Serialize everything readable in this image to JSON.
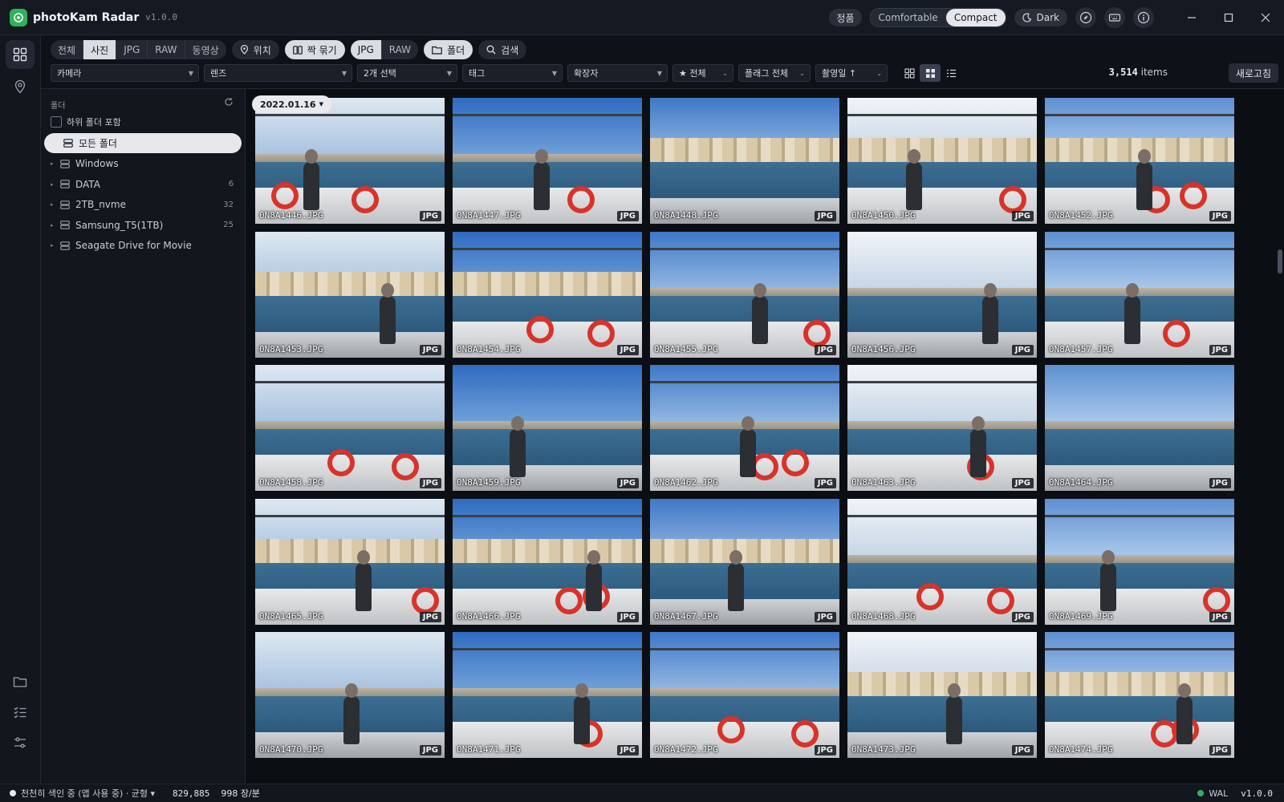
{
  "app": {
    "title": "photoKam Radar",
    "version": "v1.0.0"
  },
  "titlebar": {
    "license": "정품",
    "density": [
      "Comfortable",
      "Compact"
    ],
    "theme": "Dark"
  },
  "toolbar": {
    "media_types": [
      "전체",
      "사진",
      "JPG",
      "RAW",
      "동영상"
    ],
    "location": "위치",
    "pair": "짝 묶기",
    "formats": [
      "JPG",
      "RAW"
    ],
    "folder": "폴더",
    "search": "검색"
  },
  "filters": {
    "camera": "카메라",
    "lens": "렌즈",
    "selected": "2개 선택",
    "tag": "태그",
    "extension": "확장자",
    "rating": "★ 전체",
    "flag": "플래그 전체",
    "sort": "촬영일 ↑",
    "items_count": "3,514",
    "items_label": "items",
    "refresh": "새로고침"
  },
  "folders": {
    "title": "폴더",
    "include_sub": "하위 폴더 포함",
    "items": [
      {
        "label": "모든 폴더",
        "count": ""
      },
      {
        "label": "Windows",
        "count": ""
      },
      {
        "label": "DATA",
        "count": "6"
      },
      {
        "label": "2TB_nvme",
        "count": "32"
      },
      {
        "label": "Samsung_T5(1TB)",
        "count": "25"
      },
      {
        "label": "Seagate Drive for Movie",
        "count": ""
      }
    ]
  },
  "grid": {
    "date": "2022.01.16",
    "photos": [
      {
        "name": "0N8A1446.JPG",
        "type": "JPG"
      },
      {
        "name": "0N8A1447.JPG",
        "type": "JPG"
      },
      {
        "name": "0N8A1448.JPG",
        "type": "JPG"
      },
      {
        "name": "0N8A1450.JPG",
        "type": "JPG"
      },
      {
        "name": "0N8A1452.JPG",
        "type": "JPG"
      },
      {
        "name": "0N8A1453.JPG",
        "type": "JPG"
      },
      {
        "name": "0N8A1454.JPG",
        "type": "JPG"
      },
      {
        "name": "0N8A1455.JPG",
        "type": "JPG"
      },
      {
        "name": "0N8A1456.JPG",
        "type": "JPG"
      },
      {
        "name": "0N8A1457.JPG",
        "type": "JPG"
      },
      {
        "name": "0N8A1458.JPG",
        "type": "JPG"
      },
      {
        "name": "0N8A1459.JPG",
        "type": "JPG"
      },
      {
        "name": "0N8A1462.JPG",
        "type": "JPG"
      },
      {
        "name": "0N8A1463.JPG",
        "type": "JPG"
      },
      {
        "name": "0N8A1464.JPG",
        "type": "JPG"
      },
      {
        "name": "0N8A1465.JPG",
        "type": "JPG"
      },
      {
        "name": "0N8A1466.JPG",
        "type": "JPG"
      },
      {
        "name": "0N8A1467.JPG",
        "type": "JPG"
      },
      {
        "name": "0N8A1468.JPG",
        "type": "JPG"
      },
      {
        "name": "0N8A1469.JPG",
        "type": "JPG"
      },
      {
        "name": "0N8A1470.JPG",
        "type": "JPG"
      },
      {
        "name": "0N8A1471.JPG",
        "type": "JPG"
      },
      {
        "name": "0N8A1472.JPG",
        "type": "JPG"
      },
      {
        "name": "0N8A1473.JPG",
        "type": "JPG"
      },
      {
        "name": "0N8A1474.JPG",
        "type": "JPG"
      }
    ]
  },
  "status": {
    "indexing": "천천히 색인 중 (앱 사용 중) · 균형 ▾",
    "total": "829,885",
    "rate": "998 장/분",
    "db_mode": "WAL",
    "version": "v1.0.0"
  },
  "colors": {
    "accent_green": "#2fb35a",
    "selected_bg": "#e6e8ec",
    "ring_red": "#d8332a"
  }
}
